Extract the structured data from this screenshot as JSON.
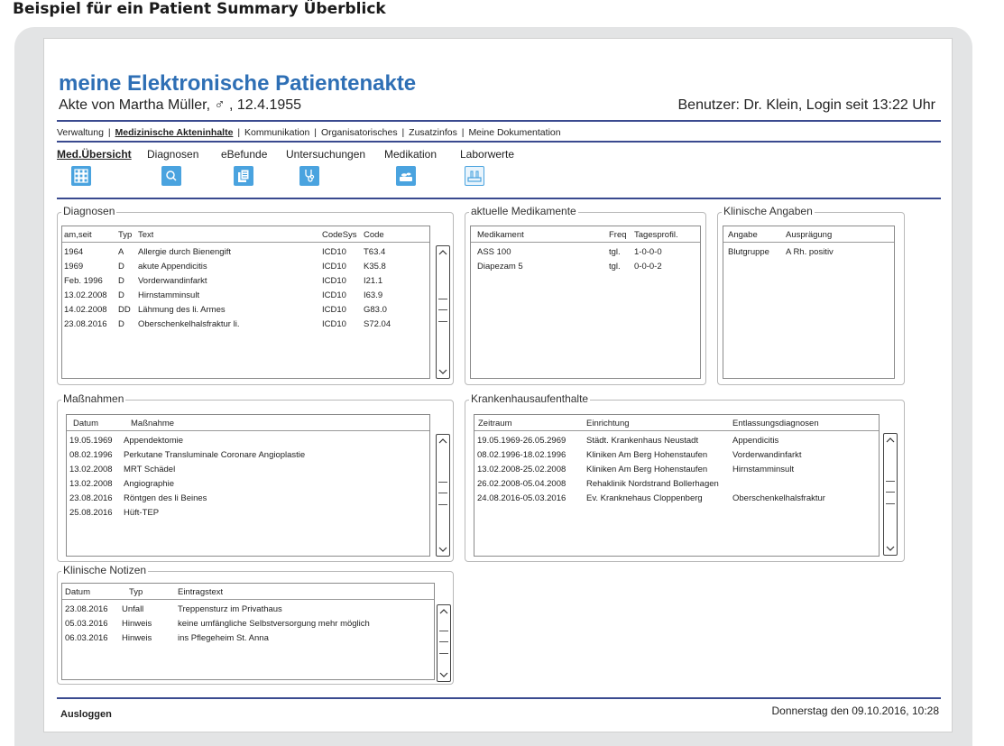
{
  "caption": "Beispiel für ein Patient Summary Überblick",
  "header": {
    "app_title": "meine Elektronische Patientenakte",
    "patient_line": "Akte von Martha Müller, ♂ , 12.4.1955",
    "user_line": "Benutzer: Dr. Klein, Login seit 13:22 Uhr"
  },
  "top_nav": [
    "Verwaltung",
    "Medizinische Akteninhalte",
    "Kommunikation",
    "Organisatorisches",
    "Zusatzinfos",
    "Meine Dokumentation"
  ],
  "sub_nav": [
    "Med.Übersicht",
    "Diagnosen",
    "eBefunde",
    "Untersuchungen",
    "Medikation",
    "Laborwerte"
  ],
  "icons": [
    "grid-icon",
    "search-icon",
    "documents-icon",
    "stethoscope-icon",
    "medication-icon",
    "lab-icon"
  ],
  "accent_color": "#4aa3df",
  "rule_color": "#3a4a8f",
  "diagnosen": {
    "title": "Diagnosen",
    "headers": [
      "am,seit",
      "Typ",
      "Text",
      "CodeSys",
      "Code"
    ],
    "rows": [
      [
        "1964",
        "A",
        "Allergie durch Bienengift",
        "ICD10",
        "T63.4"
      ],
      [
        "1969",
        "D",
        "akute Appendicitis",
        "ICD10",
        "K35.8"
      ],
      [
        "Feb. 1996",
        "D",
        "Vorderwandinfarkt",
        "ICD10",
        "I21.1"
      ],
      [
        "13.02.2008",
        "D",
        "Hirnstamminsult",
        "ICD10",
        "I63.9"
      ],
      [
        "14.02.2008",
        "DD",
        "Lähmung des li. Armes",
        "ICD10",
        "G83.0"
      ],
      [
        "23.08.2016",
        "D",
        "Oberschenkelhalsfraktur li.",
        "ICD10",
        "S72.04"
      ]
    ]
  },
  "medikamente": {
    "title": "aktuelle Medikamente",
    "headers": [
      "Medikament",
      "Freq",
      "Tagesprofil."
    ],
    "rows": [
      [
        "ASS 100",
        "tgl.",
        "1-0-0-0"
      ],
      [
        "Diapezam 5",
        "tgl.",
        "0-0-0-2"
      ]
    ]
  },
  "klinische_angaben": {
    "title": "Klinische Angaben",
    "headers": [
      "Angabe",
      "Ausprägung"
    ],
    "rows": [
      [
        "Blutgruppe",
        "A Rh. positiv"
      ]
    ]
  },
  "massnahmen": {
    "title": "Maßnahmen",
    "headers": [
      "Datum",
      "Maßnahme"
    ],
    "rows": [
      [
        "19.05.1969",
        "Appendektomie"
      ],
      [
        "08.02.1996",
        "Perkutane Transluminale Coronare Angioplastie"
      ],
      [
        "13.02.2008",
        "MRT Schädel"
      ],
      [
        "13.02.2008",
        "Angiographie"
      ],
      [
        "23.08.2016",
        "Röntgen des li Beines"
      ],
      [
        "25.08.2016",
        "Hüft-TEP"
      ]
    ]
  },
  "krankenhaus": {
    "title": "Krankenhausaufenthalte",
    "headers": [
      "Zeitraum",
      "Einrichtung",
      "Entlassungsdiagnosen"
    ],
    "rows": [
      [
        "19.05.1969-26.05.2969",
        "Städt. Krankenhaus Neustadt",
        "Appendicitis"
      ],
      [
        "08.02.1996-18.02.1996",
        "Kliniken Am Berg Hohenstaufen",
        "Vorderwandinfarkt"
      ],
      [
        "13.02.2008-25.02.2008",
        "Kliniken Am Berg Hohenstaufen",
        "Hirnstamminsult"
      ],
      [
        "26.02.2008-05.04.2008",
        "Rehaklinik Nordstrand Bollerhagen",
        ""
      ],
      [
        "24.08.2016-05.03.2016",
        "Ev. Kranknehaus Cloppenberg",
        "Oberschenkelhalsfraktur"
      ]
    ]
  },
  "notizen": {
    "title": "Klinische Notizen",
    "headers": [
      "Datum",
      "Typ",
      "Eintragstext"
    ],
    "rows": [
      [
        "23.08.2016",
        "Unfall",
        "Treppensturz im Privathaus"
      ],
      [
        "05.03.2016",
        "Hinweis",
        "keine umfängliche Selbstversorgung mehr möglich"
      ],
      [
        "06.03.2016",
        "Hinweis",
        "ins Pflegeheim St. Anna"
      ]
    ]
  },
  "footer": {
    "logout_label": "Ausloggen",
    "datetime": "Donnerstag den 09.10.2016, 10:28"
  }
}
